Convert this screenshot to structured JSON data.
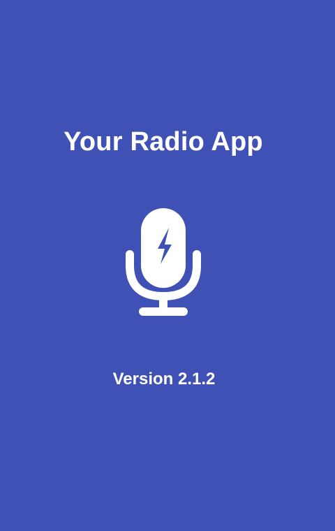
{
  "splash": {
    "title": "Your Radio App",
    "version_label": "Version 2.1.2",
    "logo_icon": "microphone-bolt-icon",
    "colors": {
      "background": "#3f51b5",
      "foreground": "#ffffff"
    }
  }
}
